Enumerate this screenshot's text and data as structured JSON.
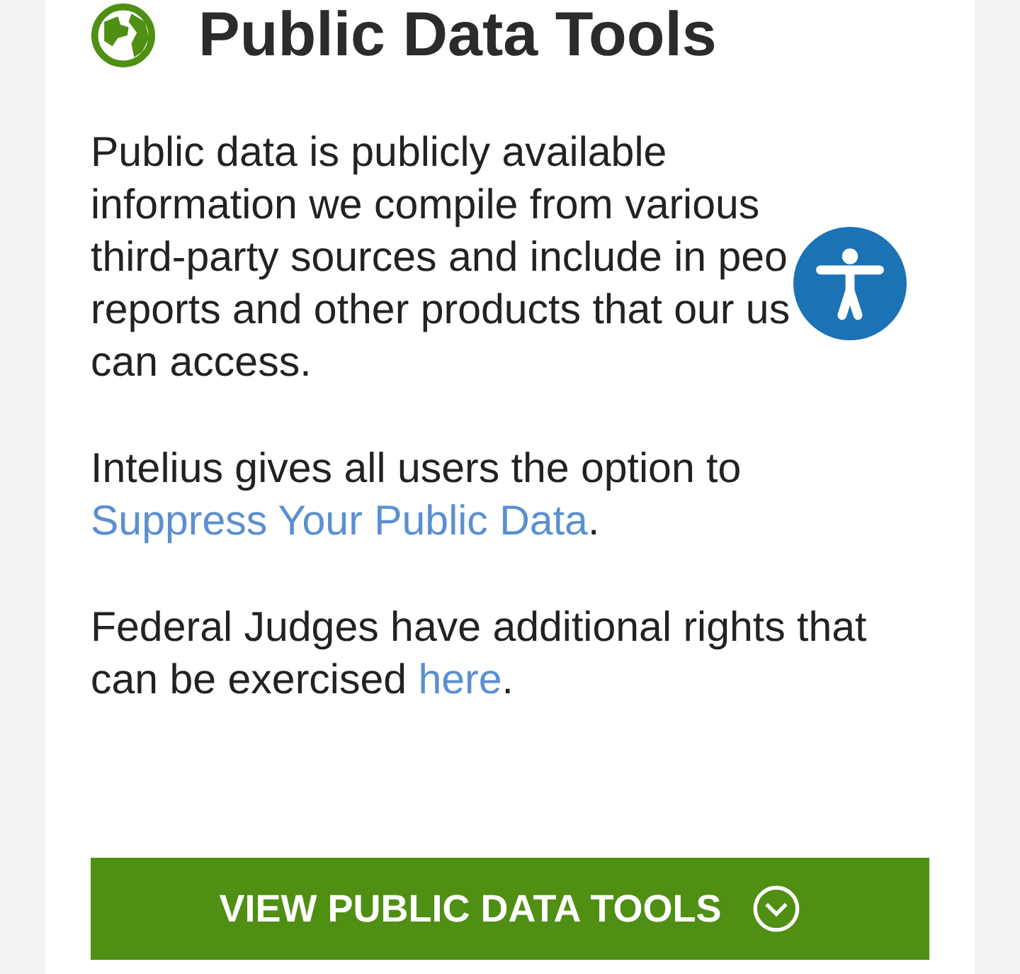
{
  "title": "Public Data Tools",
  "intro_lines": [
    "Public data is publicly available",
    "information we compile from various",
    "third-party sources and include in peo",
    "reports and other products that our us",
    "can access."
  ],
  "paragraphs": [
    {
      "segments": [
        {
          "kind": "text",
          "text": "Intelius gives all users the option to"
        },
        {
          "kind": "break"
        },
        {
          "kind": "link",
          "text": "Suppress Your Public Data"
        },
        {
          "kind": "text",
          "text": "."
        }
      ]
    },
    {
      "segments": [
        {
          "kind": "text",
          "text": "Federal Judges have additional rights that"
        },
        {
          "kind": "break"
        },
        {
          "kind": "text",
          "text": "can be exercised "
        },
        {
          "kind": "link",
          "text": "here"
        },
        {
          "kind": "text",
          "text": "."
        }
      ]
    }
  ],
  "button": {
    "label": "VIEW PUBLIC DATA TOOLS"
  }
}
